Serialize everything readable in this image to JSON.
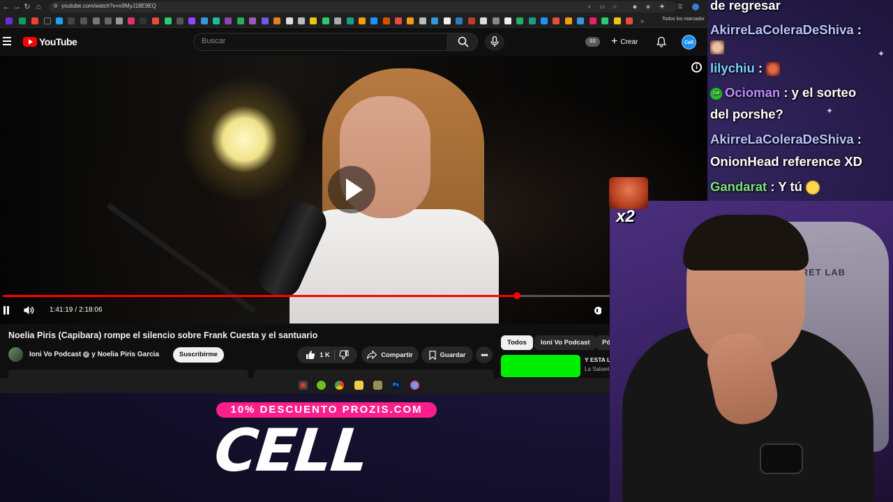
{
  "browser": {
    "url": "youtube.com/watch?v=o9MyJ18E9EQ",
    "bookmarks_folder": "Todos los marcador"
  },
  "youtube": {
    "wordmark": "YouTube",
    "search_placeholder": "Buscar",
    "account_badge": "SS",
    "create_label": "Crear",
    "avatar_text": "Cell"
  },
  "player": {
    "current_time": "1:41:19",
    "separator": "/",
    "duration": "2:18:06",
    "progress_fraction": 0.733
  },
  "video": {
    "title": "Noelia Piris (Capibara) rompe el silencio sobre Frank Cuesta y el santuario",
    "channel": "Ioni Vo Podcast",
    "collaborator": "y Noelia Piris Garcia",
    "subscribe_label": "Suscribirme",
    "likes": "1 K",
    "share_label": "Compartir",
    "save_label": "Guardar"
  },
  "sidebar": {
    "chips": [
      "Todos",
      "Ioni Vo Podcast",
      "Pó"
    ],
    "rec_title": "Y ESTA L",
    "rec_channel": "La Salseri"
  },
  "chat": {
    "messages": [
      {
        "user": "",
        "text": "de regresar"
      },
      {
        "user": "AkirreLaColeraDeShiva",
        "text": ":"
      },
      {
        "user": "lilychiu",
        "text": ":"
      },
      {
        "user": "Ocioman",
        "text": ": y el sorteo"
      },
      {
        "user": "",
        "text": "del porshe?"
      },
      {
        "user": "AkirreLaColeraDeShiva",
        "text": ":"
      },
      {
        "user": "",
        "text": "OnionHead reference XD"
      },
      {
        "user": "Gandarat",
        "text": ": Y tú"
      }
    ],
    "colors": {
      "akirre": "#b9c4ff",
      "lilychiu": "#7ad3ff",
      "ocioman": "#c08cff",
      "gandarat": "#7fe07f"
    }
  },
  "overlay": {
    "emote_count": "x2",
    "chair_brand": "SECRET LAB",
    "promo": "10% DESCUENTO PROZIS.COM",
    "sponsor_logo": "CELL"
  },
  "colors": {
    "youtube_red": "#ff0000",
    "promo_pink": "#ff1e8c",
    "rec_thumb_green": "#00ee00"
  }
}
